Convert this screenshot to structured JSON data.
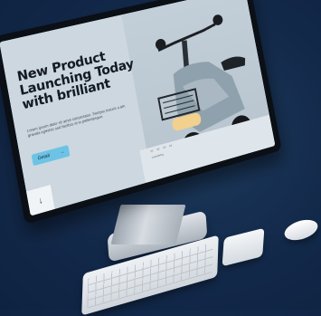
{
  "hero": {
    "headline": "New Product Launching Today with brilliant",
    "body": "Lorem ipsum dolor sit amet consectetur. Semper mauris a am gravida egestas sed facilisis et in pellentesque.",
    "cta_label": "Detail",
    "cta_arrow": "→",
    "scroll_arrow": "↓"
  },
  "bottom_strip": {
    "tabs": [
      "01",
      "02",
      "03",
      "04"
    ],
    "subtitle": "Launching"
  },
  "colors": {
    "background": "#13294a",
    "cta": "#6cc3e6",
    "screen": "#c9d4dc"
  }
}
